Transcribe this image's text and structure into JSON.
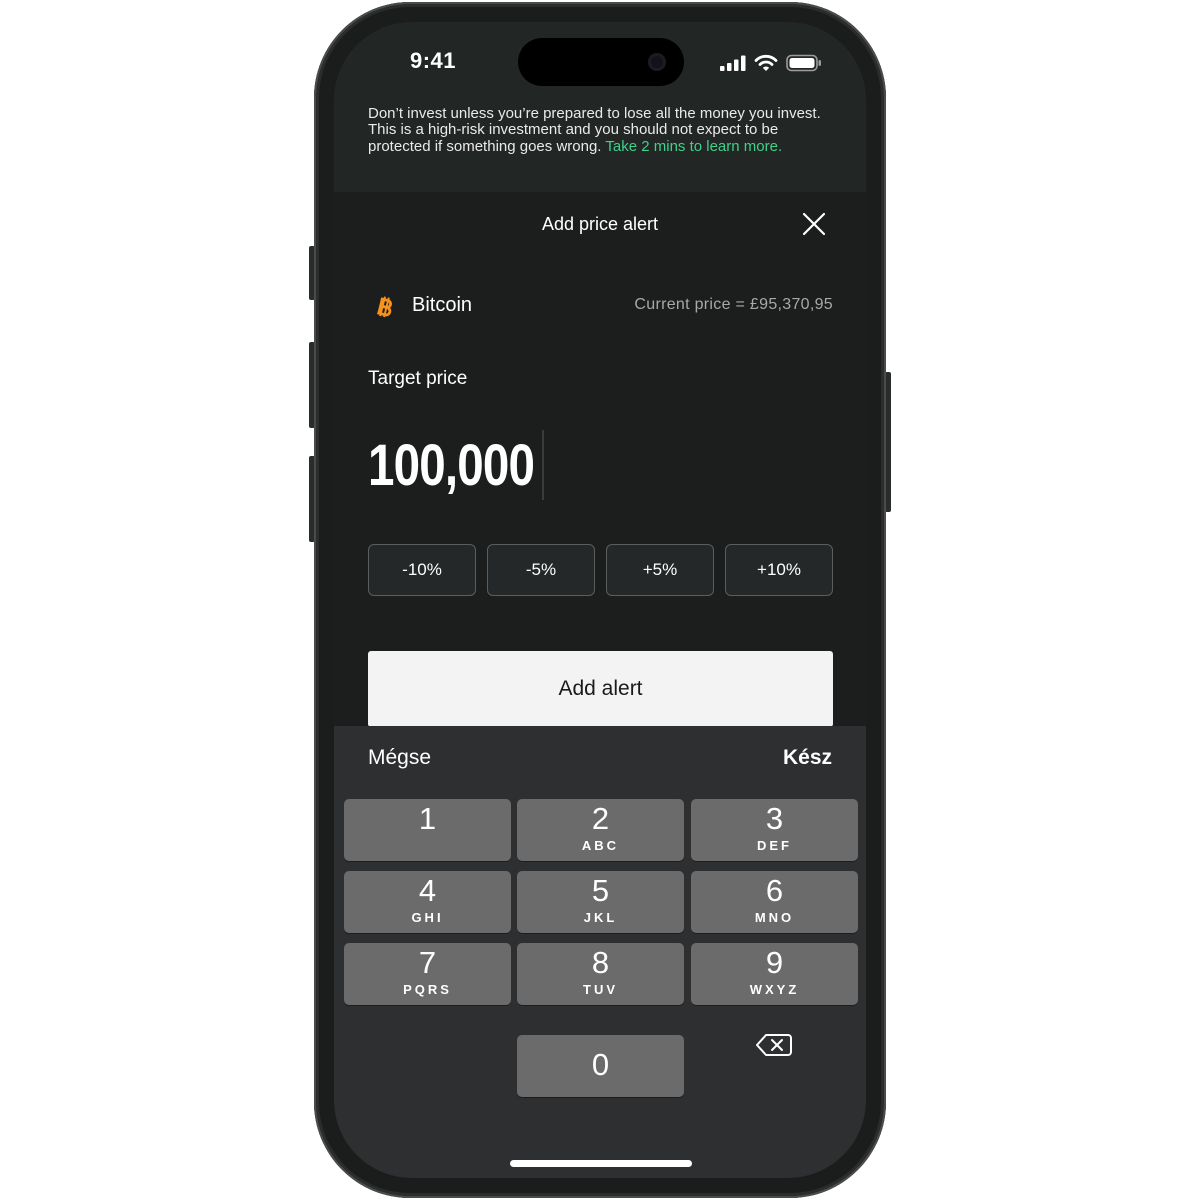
{
  "status_bar": {
    "time": "9:41"
  },
  "risk_banner": {
    "text": "Don’t invest unless you’re prepared to lose all the money you invest. This is a high-risk investment and you should not expect to be protected if something goes wrong. ",
    "link_text": "Take 2 mins to learn more.",
    "link_color": "#3fd08a"
  },
  "sheet": {
    "title": "Add price alert",
    "asset_name": "Bitcoin",
    "current_price": "Current price = £95,370,95",
    "target_label": "Target price",
    "target_value": "100,000",
    "percent_buttons": [
      "-10%",
      "-5%",
      "+5%",
      "+10%"
    ],
    "add_button_label": "Add alert"
  },
  "keyboard": {
    "cancel_label": "Mégse",
    "done_label": "Kész",
    "keys": [
      {
        "num": "1",
        "letters": ""
      },
      {
        "num": "2",
        "letters": "ABC"
      },
      {
        "num": "3",
        "letters": "DEF"
      },
      {
        "num": "4",
        "letters": "GHI"
      },
      {
        "num": "5",
        "letters": "JKL"
      },
      {
        "num": "6",
        "letters": "MNO"
      },
      {
        "num": "7",
        "letters": "PQRS"
      },
      {
        "num": "8",
        "letters": "TUV"
      },
      {
        "num": "9",
        "letters": "WXYZ"
      },
      {
        "num": "0",
        "letters": ""
      }
    ]
  },
  "icons": {
    "asset": "bitcoin-icon",
    "close": "close-icon",
    "backspace": "backspace-icon"
  },
  "colors": {
    "bitcoin_orange": "#f7931a",
    "sheet_background": "#1c1e1e",
    "keyboard_background": "#2d2f31",
    "key_background": "#6b6b6b"
  }
}
